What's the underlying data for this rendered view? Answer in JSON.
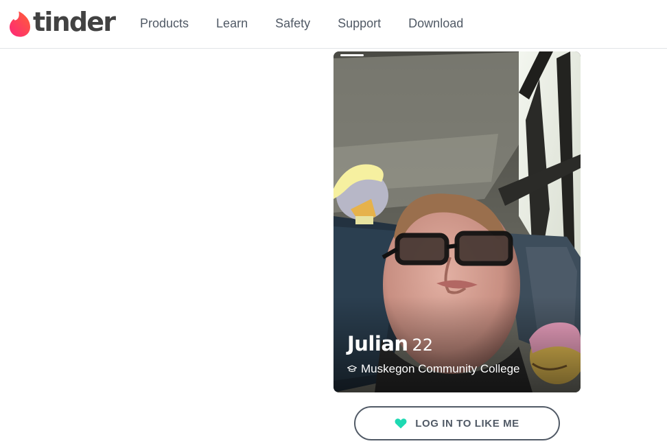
{
  "brand": {
    "name": "tinder",
    "accent_gradient": [
      "#fd267a",
      "#ff6036"
    ]
  },
  "nav": {
    "items": [
      {
        "label": "Products"
      },
      {
        "label": "Learn"
      },
      {
        "label": "Safety"
      },
      {
        "label": "Support"
      },
      {
        "label": "Download"
      }
    ]
  },
  "profile": {
    "name": "Julian",
    "age": "22",
    "school": "Muskegon Community College",
    "school_icon": "graduation-cap-icon",
    "photo_index": 1
  },
  "cta": {
    "label": "LOG IN TO LIKE ME",
    "icon": "heart-icon",
    "icon_color": "#1ed9b2"
  }
}
